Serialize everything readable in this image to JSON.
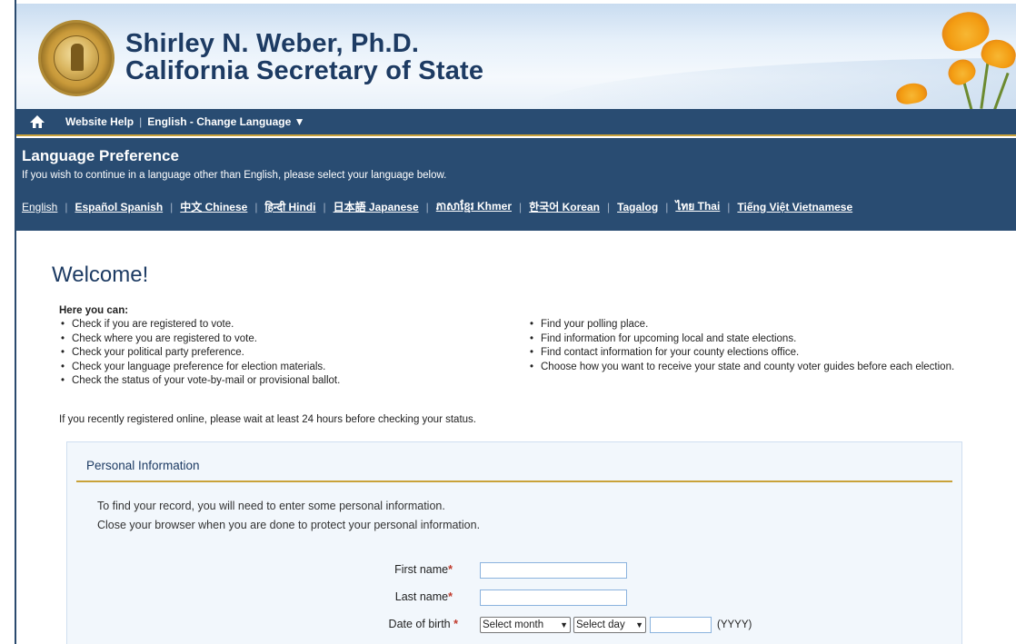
{
  "header": {
    "title_line1": "Shirley N. Weber, Ph.D.",
    "title_line2": "California Secretary of State"
  },
  "nav": {
    "home_icon": "home-icon",
    "website_help": "Website Help",
    "change_language": "English - Change Language ▼"
  },
  "language": {
    "title": "Language Preference",
    "description": "If you wish to continue in a language other than English, please select your language below.",
    "links": [
      "English",
      "Español Spanish",
      "中文 Chinese",
      "हिन्दी Hindi",
      "日本語 Japanese",
      "ភាសាខ្មែរ Khmer",
      "한국어 Korean",
      "Tagalog",
      "ไทย Thai",
      "Tiếng Việt Vietnamese"
    ]
  },
  "welcome": {
    "heading": "Welcome!",
    "here_label": "Here you can:",
    "left_items": [
      "Check if you are registered to vote.",
      "Check where you are registered to vote.",
      "Check your political party preference.",
      "Check your language preference for election materials.",
      "Check the status of your vote-by-mail or provisional ballot."
    ],
    "right_items": [
      "Find your polling place.",
      "Find information for upcoming local and state elections.",
      "Find contact information for your county elections office.",
      "Choose how you want to receive your state and county voter guides before each election."
    ],
    "recent_note": "If you recently registered online, please wait at least 24 hours before checking your status."
  },
  "form": {
    "section_title": "Personal Information",
    "instruction_1": "To find your record, you will need to enter some personal information.",
    "instruction_2": "Close your browser when you are done to protect your personal information.",
    "first_name_label": "First name",
    "last_name_label": "Last name",
    "dob_label": "Date of birth",
    "required_mark": "*",
    "month_select": "Select month",
    "day_select": "Select day",
    "year_hint": "(YYYY)",
    "first_name_value": "",
    "last_name_value": "",
    "year_value": ""
  }
}
